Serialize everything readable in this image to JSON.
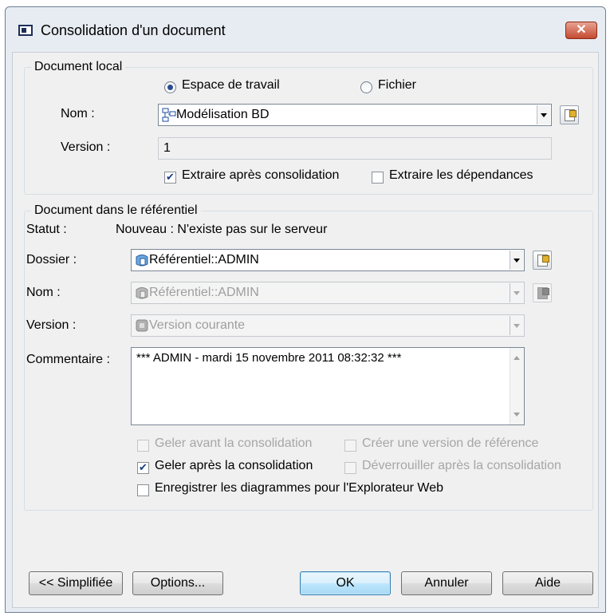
{
  "window": {
    "title": "Consolidation d'un document",
    "close_label": "✕"
  },
  "local": {
    "group_label": "Document local",
    "radio_workspace": "Espace de travail",
    "radio_file": "Fichier",
    "name_label": "Nom :",
    "name_value": "Modélisation BD",
    "version_label": "Version :",
    "version_value": "1",
    "check_extract_after": "Extraire après consolidation",
    "check_extract_deps": "Extraire les dépendances"
  },
  "repo": {
    "group_label": "Document dans le référentiel",
    "status_label": "Statut :",
    "status_value": "Nouveau : N'existe pas sur le serveur",
    "folder_label": "Dossier :",
    "folder_value": "Référentiel::ADMIN",
    "name_label": "Nom :",
    "name_value": "Référentiel::ADMIN",
    "version_label": "Version :",
    "version_value": "Version courante",
    "comment_label": "Commentaire :",
    "comment_value": "*** ADMIN - mardi 15 novembre 2011 08:32:32 ***",
    "check_freeze_before": "Geler avant la consolidation",
    "check_create_ref": "Créer une version de référence",
    "check_freeze_after": "Geler après la consolidation",
    "check_unlock_after": "Déverrouiller après la consolidation",
    "check_save_diagrams": "Enregistrer les diagrammes pour l'Explorateur Web"
  },
  "buttons": {
    "simplified": "<< Simplifiée",
    "options": "Options...",
    "ok": "OK",
    "cancel": "Annuler",
    "help": "Aide"
  },
  "icons": {
    "window": "window-icon",
    "model": "model-icon",
    "repository": "repository-icon",
    "version": "version-icon",
    "properties": "properties-icon"
  }
}
